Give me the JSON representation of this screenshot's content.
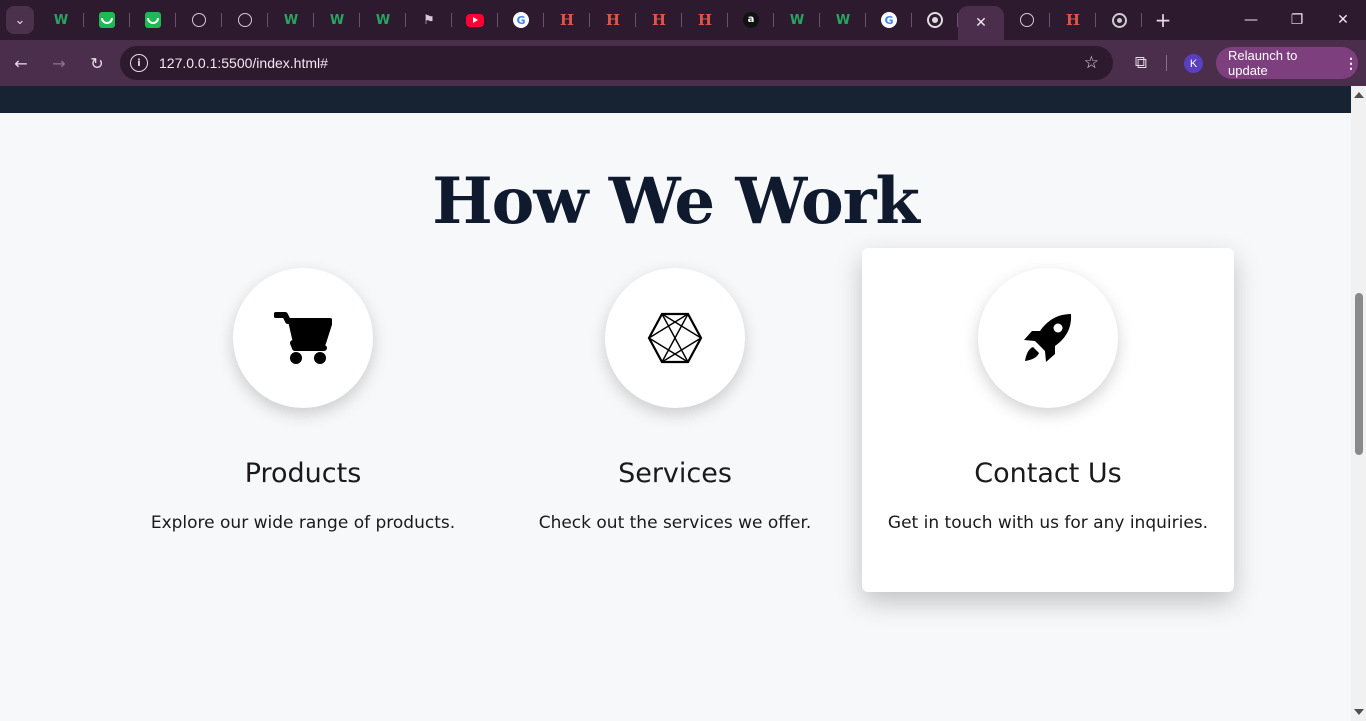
{
  "browser": {
    "url": "127.0.0.1:5500/index.html#",
    "relaunch_label": "Relaunch to update",
    "profile_initial": "K",
    "tabs": [
      {
        "icon": "webflow-w-icon"
      },
      {
        "icon": "green-app-icon"
      },
      {
        "icon": "green-app-icon"
      },
      {
        "icon": "globe-icon"
      },
      {
        "icon": "globe-icon"
      },
      {
        "icon": "webflow-w-icon"
      },
      {
        "icon": "webflow-w-icon"
      },
      {
        "icon": "webflow-w-icon"
      },
      {
        "icon": "flag-icon"
      },
      {
        "icon": "youtube-icon"
      },
      {
        "icon": "google-icon"
      },
      {
        "icon": "hackerrank-h-icon"
      },
      {
        "icon": "hackerrank-h-icon"
      },
      {
        "icon": "hackerrank-h-icon"
      },
      {
        "icon": "hackerrank-h-icon"
      },
      {
        "icon": "amazon-a-icon"
      },
      {
        "icon": "webflow-w-icon"
      },
      {
        "icon": "webflow-w-icon"
      },
      {
        "icon": "google-icon"
      },
      {
        "icon": "ring-icon"
      },
      {
        "icon": "close-icon",
        "active": true
      },
      {
        "icon": "globe-icon"
      },
      {
        "icon": "hackerrank-h-icon"
      },
      {
        "icon": "chrome-icon"
      }
    ]
  },
  "page": {
    "heading": "How We Work",
    "cards": [
      {
        "title": "Products",
        "description": "Explore our wide range of products.",
        "icon": "shopping-cart-icon"
      },
      {
        "title": "Services",
        "description": "Check out the services we offer.",
        "icon": "hexagon-network-icon"
      },
      {
        "title": "Contact Us",
        "description": "Get in touch with us for any inquiries.",
        "icon": "rocket-icon"
      }
    ]
  },
  "colors": {
    "tabstrip_bg": "#2e1a2e",
    "toolbar_bg": "#4b2e4b",
    "relaunch_bg": "#7d3f7d",
    "page_bg": "#f7f8fa",
    "top_band": "#172233",
    "heading_color": "#0f1a2e"
  }
}
